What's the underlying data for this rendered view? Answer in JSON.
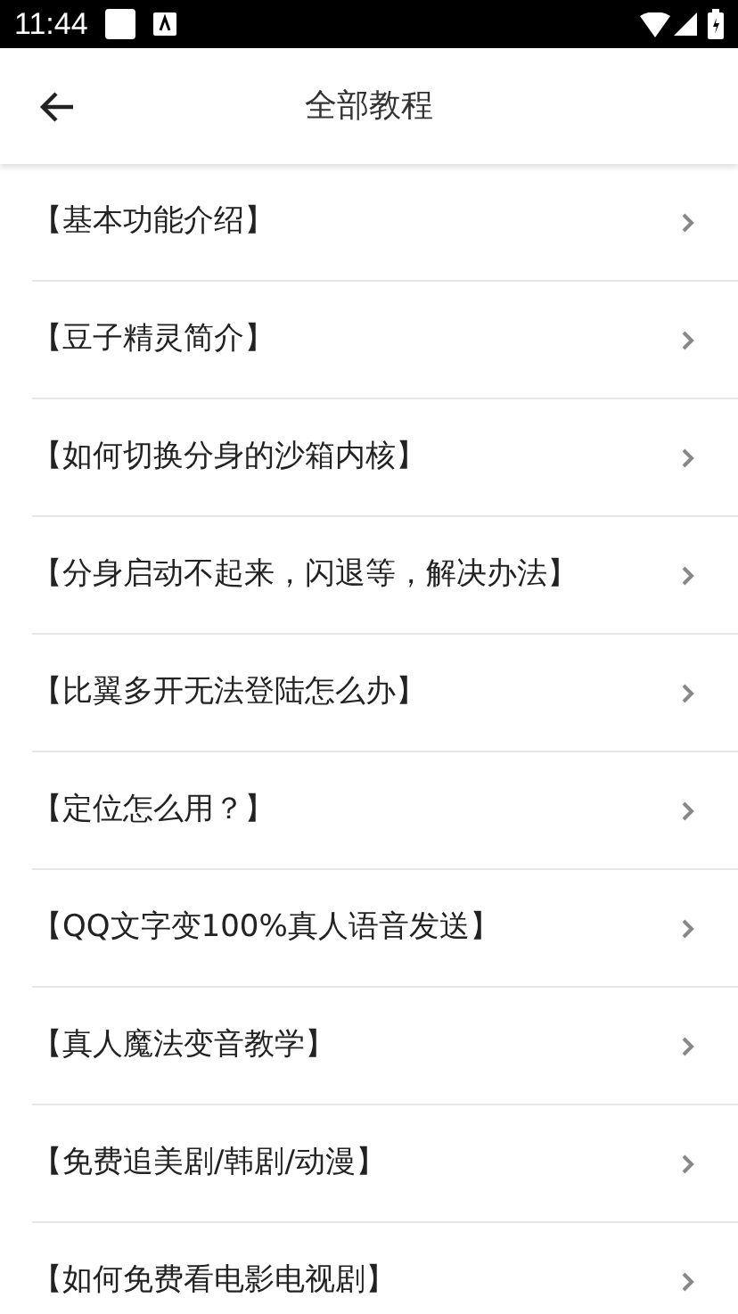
{
  "status_bar": {
    "time": "11:44"
  },
  "header": {
    "title": "全部教程"
  },
  "items": [
    {
      "label": "【基本功能介绍】"
    },
    {
      "label": "【豆子精灵简介】"
    },
    {
      "label": "【如何切换分身的沙箱内核】"
    },
    {
      "label": "【分身启动不起来，闪退等，解决办法】"
    },
    {
      "label": "【比翼多开无法登陆怎么办】"
    },
    {
      "label": "【定位怎么用？】"
    },
    {
      "label": "【QQ文字变100%真人语音发送】"
    },
    {
      "label": "【真人魔法变音教学】"
    },
    {
      "label": "【免费追美剧/韩剧/动漫】"
    },
    {
      "label": "【如何免费看电影电视剧】"
    }
  ]
}
